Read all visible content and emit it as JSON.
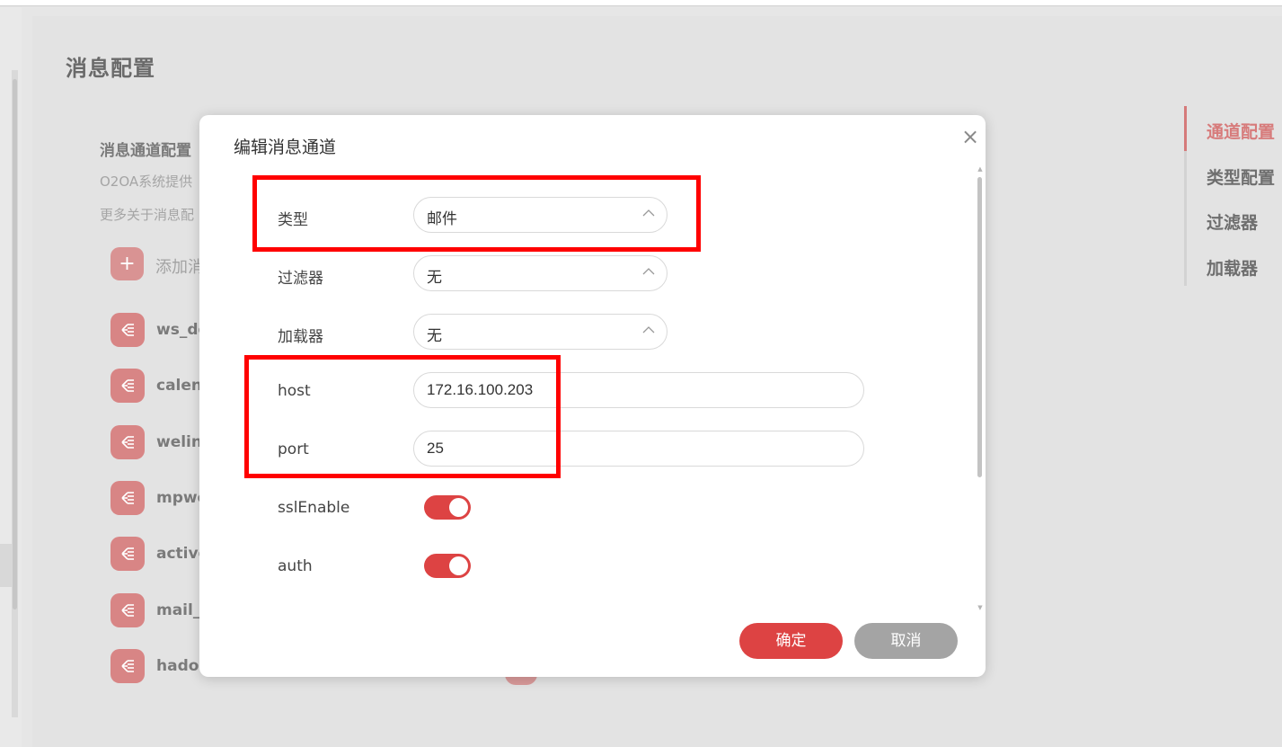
{
  "page": {
    "title": "消息配置"
  },
  "section": {
    "title": "消息通道配置",
    "desc_line1": "O2OA系统提供",
    "desc_line2": "更多关于消息配",
    "add_label": "添加消"
  },
  "channels": [
    {
      "label": "ws_de"
    },
    {
      "label": "calenc"
    },
    {
      "label": "welinl"
    },
    {
      "label": "mpwe"
    },
    {
      "label": "active"
    },
    {
      "label": "mail_c"
    },
    {
      "label": "hadoo"
    }
  ],
  "right_nav": {
    "items": [
      {
        "label": "通道配置",
        "active": true
      },
      {
        "label": "类型配置",
        "active": false
      },
      {
        "label": "过滤器",
        "active": false
      },
      {
        "label": "加载器",
        "active": false
      }
    ]
  },
  "dialog": {
    "title": "编辑消息通道",
    "close_glyph": "×",
    "fields": {
      "type": {
        "label": "类型",
        "value": "邮件"
      },
      "filter": {
        "label": "过滤器",
        "value": "无"
      },
      "loader": {
        "label": "加载器",
        "value": "无"
      },
      "host": {
        "label": "host",
        "value": "172.16.100.203"
      },
      "port": {
        "label": "port",
        "value": "25"
      },
      "sslEnable": {
        "label": "sslEnable",
        "on": true
      },
      "auth": {
        "label": "auth",
        "on": true
      }
    },
    "ok_label": "确定",
    "cancel_label": "取消"
  },
  "colors": {
    "accent": "#dd4343",
    "annotation": "#ff0000",
    "cancel": "#a4a4a4"
  }
}
